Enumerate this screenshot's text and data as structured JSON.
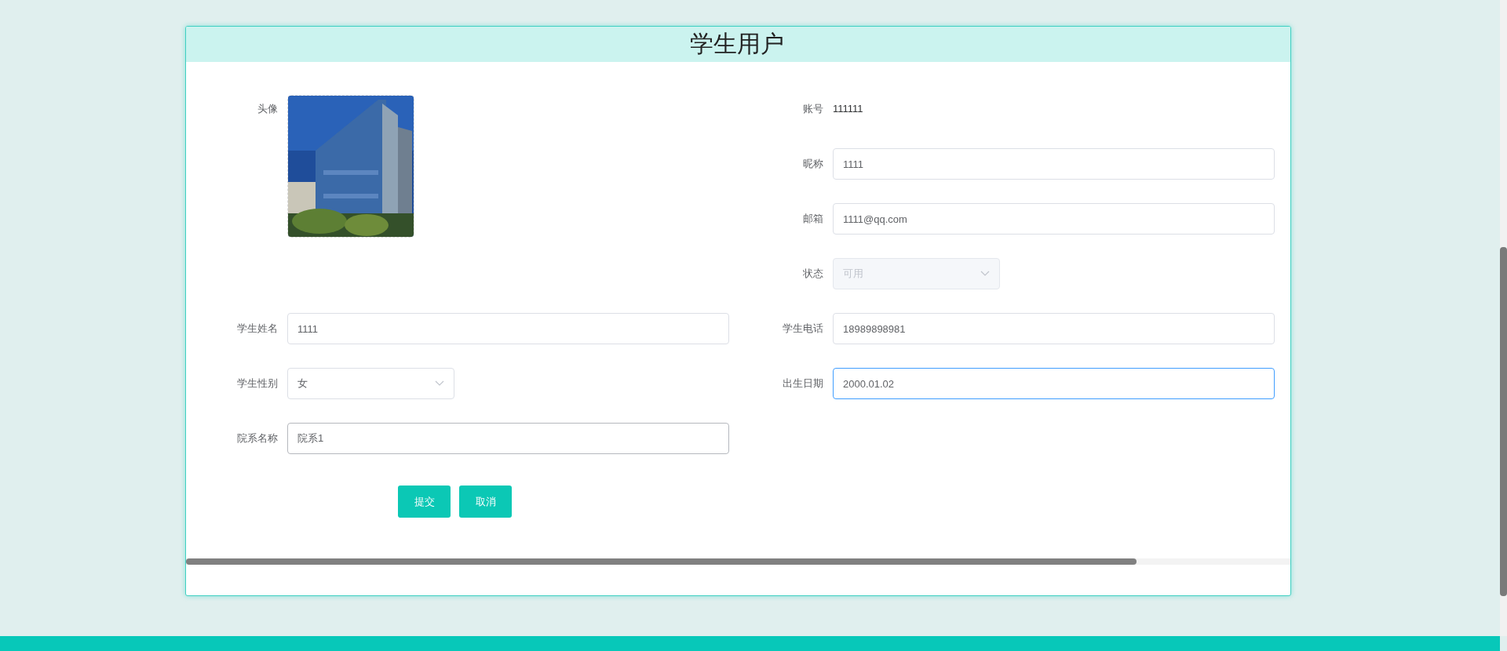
{
  "title": "学生用户",
  "fields": [
    {
      "label": "头像"
    },
    {
      "label": "账号",
      "kind": "text",
      "value": "111111"
    },
    {
      "label": "昵称",
      "kind": "input",
      "value": "1111",
      "focused": false,
      "hovered": false
    },
    {
      "label": "邮箱",
      "kind": "input",
      "value": "1111@qq.com",
      "focused": false,
      "hovered": false
    },
    {
      "label": "状态",
      "kind": "select",
      "value": "可用",
      "disabled": true
    },
    {
      "label": "学生姓名",
      "kind": "input",
      "value": "1111",
      "focused": false,
      "hovered": false
    },
    {
      "label": "学生电话",
      "kind": "input",
      "value": "18989898981",
      "focused": false,
      "hovered": false
    },
    {
      "label": "学生性别",
      "kind": "select",
      "value": "女",
      "disabled": false
    },
    {
      "label": "出生日期",
      "kind": "input",
      "value": "2000.01.02",
      "focused": true,
      "hovered": false
    },
    {
      "label": "院系名称",
      "kind": "input",
      "value": "院系1",
      "focused": false,
      "hovered": true
    }
  ],
  "buttons": [
    "提交",
    "取消"
  ]
}
